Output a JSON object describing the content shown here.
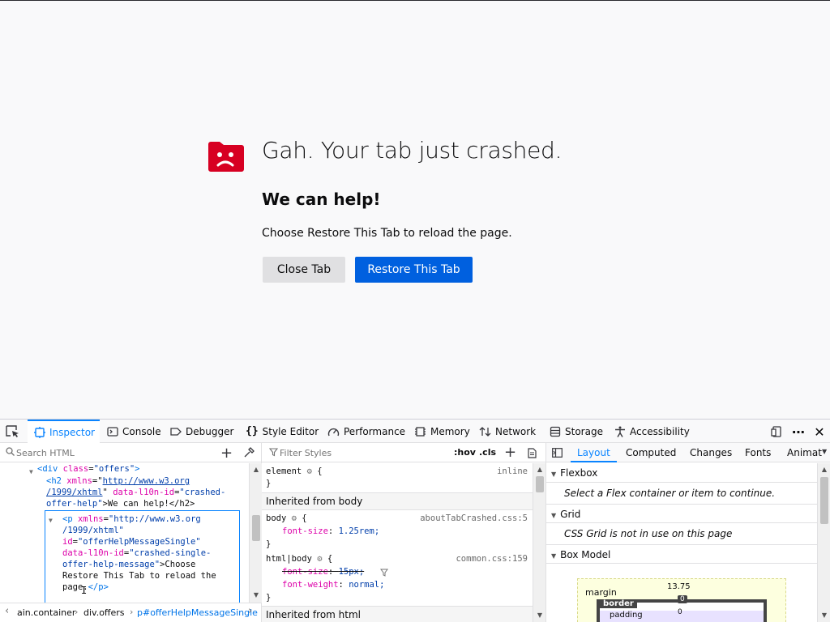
{
  "crash_page": {
    "title": "Gah. Your tab just crashed.",
    "offer_title": "We can help!",
    "offer_message": "Choose Restore This Tab to reload the page.",
    "close_tab_label": "Close Tab",
    "restore_tab_label": "Restore This Tab",
    "icon_color": "#d70022",
    "restore_color": "#0060df"
  },
  "devtools": {
    "tabs": [
      {
        "label": "Inspector",
        "icon": "inspector-icon"
      },
      {
        "label": "Console",
        "icon": "console-icon"
      },
      {
        "label": "Debugger",
        "icon": "debugger-icon"
      },
      {
        "label": "Style Editor",
        "icon": "style-editor-icon"
      },
      {
        "label": "Performance",
        "icon": "performance-icon"
      },
      {
        "label": "Memory",
        "icon": "memory-icon"
      },
      {
        "label": "Network",
        "icon": "network-icon"
      },
      {
        "label": "Storage",
        "icon": "storage-icon"
      },
      {
        "label": "Accessibility",
        "icon": "accessibility-icon"
      }
    ],
    "markup": {
      "search_placeholder": "Search HTML",
      "lines": {
        "div_open": "<div",
        "div_class_attr": "class",
        "div_class_val": "\"offers\"",
        "div_close": ">",
        "h2_open": "<h2",
        "h2_xmlns": "xmlns",
        "h2_url1": "http://www.w3.org",
        "h2_url2": "/1999/xhtml",
        "h2_attr2": "data-l10n-id",
        "h2_val2": "\"crashed-",
        "h2_val3": "offer-help\"",
        "h2_text": ">We can help!</h2>",
        "p_open": "<p",
        "p_xmlns": "xmlns",
        "p_url": "\"http://www.w3.org",
        "p_url2": "/1999/xhtml\"",
        "p_id_attr": "id",
        "p_id_val": "\"offerHelpMessageSingle\"",
        "p_l10n_attr": "data-l10n-id",
        "p_l10n_val": "\"crashed-single-",
        "p_l10n_val2": "offer-help-message\"",
        "p_text1": ">Choose",
        "p_text2": "Restore This Tab to reload the",
        "p_text3": "page.",
        "p_close": "</p>"
      }
    },
    "breadcrumbs": [
      "ain.container",
      "div.offers",
      "p#offerHelpMessageSingle"
    ],
    "rules": {
      "filter_placeholder": "Filter Styles",
      "hov": ":hov",
      "cls": ".cls",
      "element_selector": "element",
      "element_open": "{",
      "element_close": "}",
      "element_source": "inline",
      "inherited_body": "Inherited from body",
      "body_selector": "body",
      "body_open": "{",
      "body_source": "aboutTabCrashed.css:5",
      "body_prop": "font-size",
      "body_val": "1.25rem;",
      "body_close": "}",
      "html_body_selector": "html|body",
      "html_body_open": "{",
      "html_body_source": "common.css:159",
      "hb_prop1": "font-size",
      "hb_val1": "15px;",
      "hb_prop2": "font-weight",
      "hb_val2": "normal;",
      "hb_close": "}",
      "inherited_html": "Inherited from html"
    },
    "layout": {
      "tabs": [
        "Layout",
        "Computed",
        "Changes",
        "Fonts",
        "Animat"
      ],
      "flexbox_header": "Flexbox",
      "flexbox_note": "Select a Flex container or item to continue.",
      "grid_header": "Grid",
      "grid_note": "CSS Grid is not in use on this page",
      "box_model_header": "Box Model",
      "margin_label": "margin",
      "margin_top": "13.75",
      "border_label": "border",
      "border_top": "0",
      "padding_label": "padding",
      "padding_top": "0"
    }
  }
}
